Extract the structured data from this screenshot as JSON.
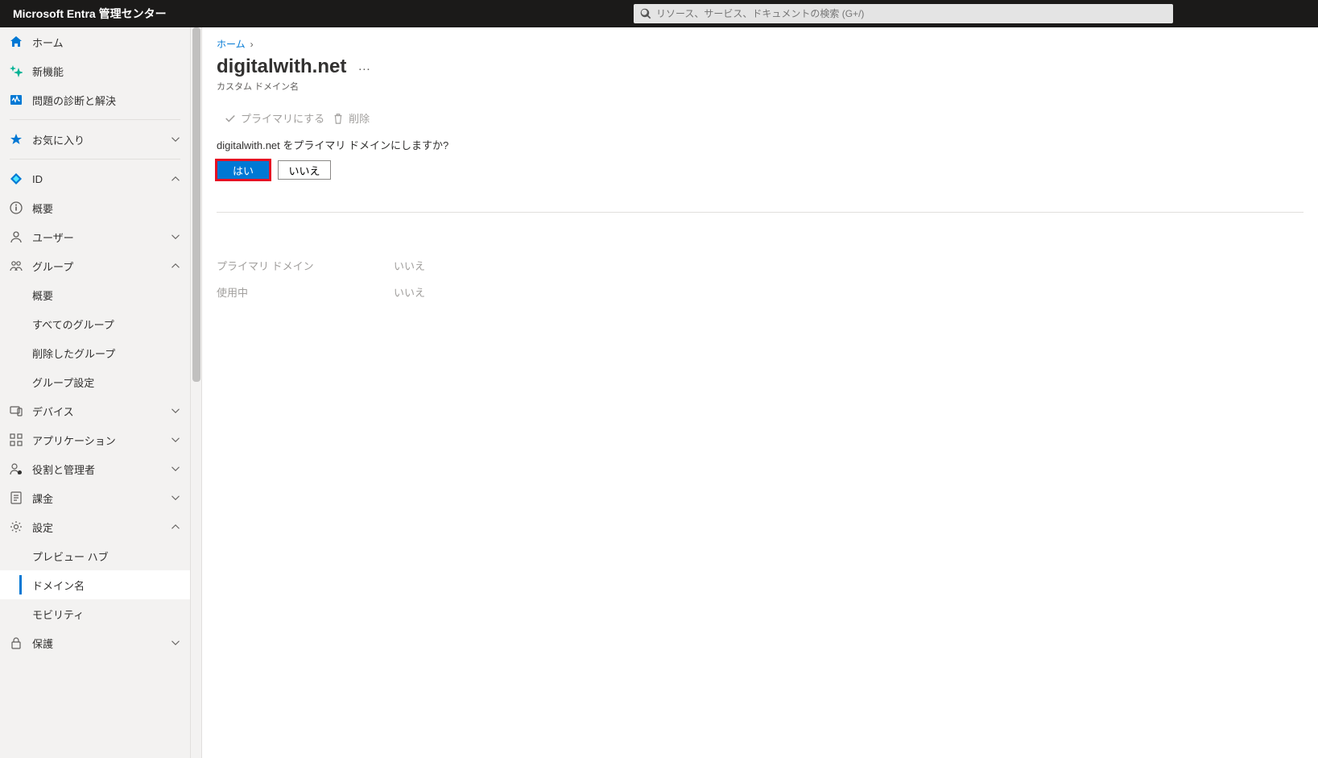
{
  "header": {
    "brand": "Microsoft Entra 管理センター",
    "search_placeholder": "リソース、サービス、ドキュメントの検索 (G+/)"
  },
  "sidebar": {
    "home": "ホーム",
    "whatsnew": "新機能",
    "diagnose": "問題の診断と解決",
    "favorites": "お気に入り",
    "id": "ID",
    "overview": "概要",
    "users": "ユーザー",
    "groups": "グループ",
    "groups_children": {
      "overview": "概要",
      "all": "すべてのグループ",
      "deleted": "削除したグループ",
      "settings": "グループ設定"
    },
    "devices": "デバイス",
    "applications": "アプリケーション",
    "roles": "役割と管理者",
    "billing": "課金",
    "settings": "設定",
    "settings_children": {
      "preview": "プレビュー ハブ",
      "domains": "ドメイン名",
      "mobility": "モビリティ"
    },
    "protection": "保護"
  },
  "breadcrumb": {
    "home": "ホーム"
  },
  "page": {
    "title": "digitalwith.net",
    "subtitle": "カスタム ドメイン名"
  },
  "toolbar": {
    "make_primary": "プライマリにする",
    "delete": "削除"
  },
  "confirm": {
    "text": "digitalwith.net をプライマリ ドメインにしますか?",
    "yes": "はい",
    "no": "いいえ"
  },
  "details": {
    "primary_label": "プライマリ ドメイン",
    "primary_value": "いいえ",
    "inuse_label": "使用中",
    "inuse_value": "いいえ"
  }
}
